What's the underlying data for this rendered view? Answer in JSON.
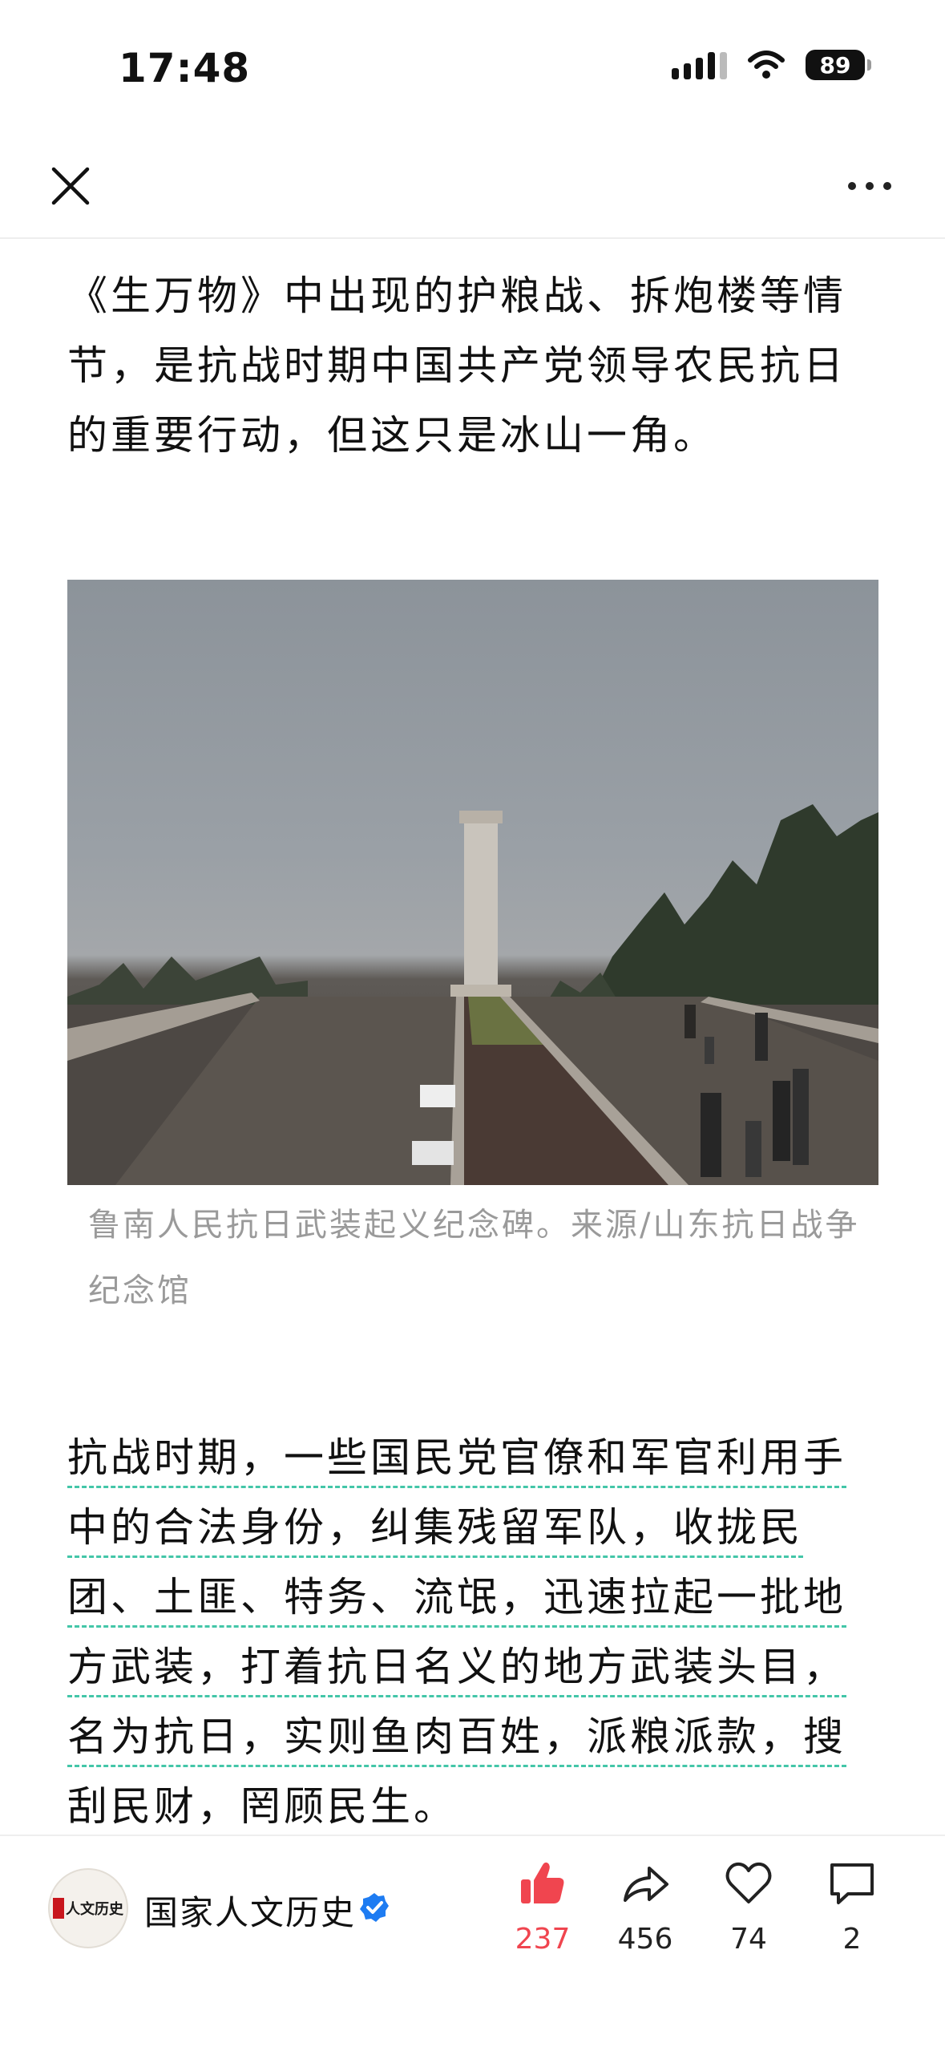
{
  "status": {
    "time": "17:48",
    "battery": "89"
  },
  "article": {
    "para1": "《生万物》中出现的护粮战、拆炮楼等情节，是抗战时期中国共产党领导农民抗日的重要行动，但这只是冰山一角。",
    "caption": "鲁南人民抗日武装起义纪念碑。来源/山东抗日战争纪念馆",
    "para2_lines": [
      "抗战时期，一些国民党官僚和军官利用手",
      "中的合法身份，纠集残留军队，收拢民",
      "团、土匪、特务、流氓，迅速拉起一批地",
      "方武装，打着抗日名义的地方武装头目，",
      "名为抗日，实则鱼肉百姓，派粮派款，搜",
      "刮民财，罔顾民生。"
    ]
  },
  "account": {
    "name": "国家人文历史",
    "avatar_text": "人文历史"
  },
  "actions": {
    "like": "237",
    "share": "456",
    "favorite": "74",
    "comment": "2"
  },
  "colors": {
    "accent": "#f0454f",
    "highlight_underline": "#43c6a8",
    "verified": "#1e7cf2"
  },
  "icons": [
    "close-icon",
    "more-icon",
    "thumbs-up-icon",
    "share-icon",
    "heart-icon",
    "comment-icon",
    "verified-icon"
  ]
}
